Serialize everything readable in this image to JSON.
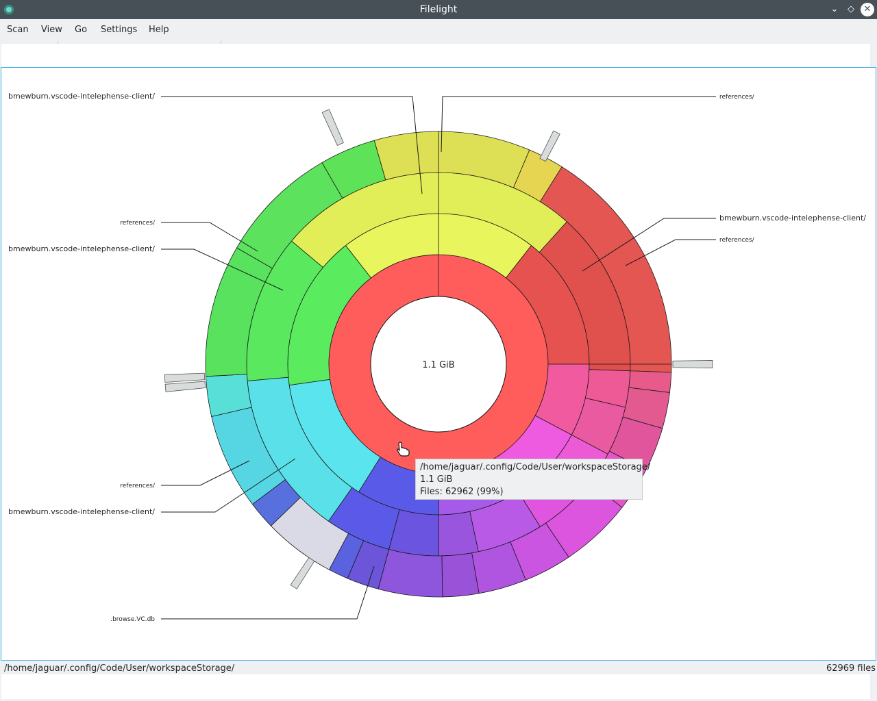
{
  "window": {
    "title": "Filelight"
  },
  "menu": [
    "Scan",
    "View",
    "Go",
    "Settings",
    "Help"
  ],
  "chart": {
    "center_label": "1.1 GiB",
    "labels": [
      "bmewburn.vscode-intelephense-client/",
      "references/",
      "references/",
      "bmewburn.vscode-intelephense-client/",
      "bmewburn.vscode-intelephense-client/",
      "references/",
      "references/",
      "bmewburn.vscode-intelephense-client/",
      ".browse.VC.db"
    ]
  },
  "tooltip": {
    "path": "/home/jaguar/.config/Code/User/workspaceStorage/",
    "size": "1.1 GiB",
    "files": "Files: 62962 (99%)"
  },
  "status": {
    "path": "/home/jaguar/.config/Code/User/workspaceStorage/",
    "count": "62969 files"
  },
  "colors": {
    "titlebar": "#475057",
    "focus": "#3daee9",
    "root_ring": "#ff5c5c"
  }
}
